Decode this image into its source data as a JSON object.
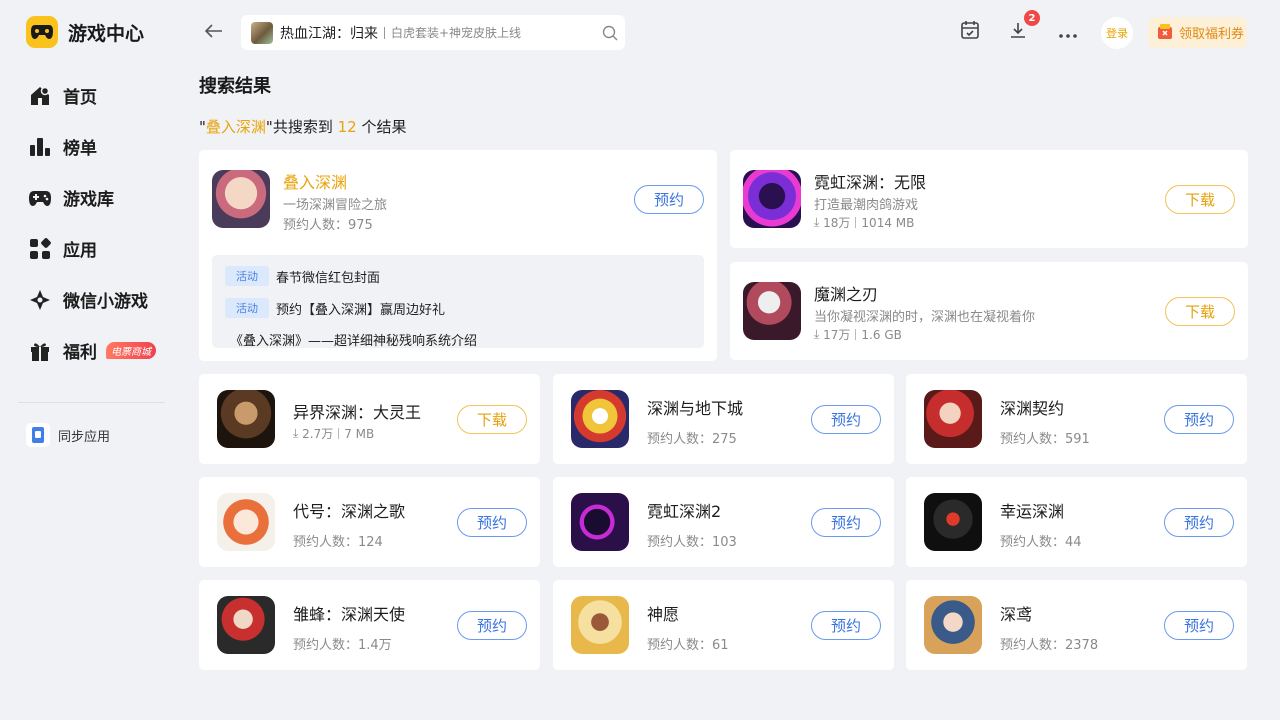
{
  "app": {
    "name": "游戏中心"
  },
  "nav": [
    {
      "id": "home",
      "label": "首页",
      "icon": "home-icon"
    },
    {
      "id": "ranking",
      "label": "榜单",
      "icon": "ranking-icon"
    },
    {
      "id": "library",
      "label": "游戏库",
      "icon": "gamepad-icon"
    },
    {
      "id": "apps",
      "label": "应用",
      "icon": "apps-icon"
    },
    {
      "id": "wechat",
      "label": "微信小游戏",
      "icon": "wechat-game-icon"
    },
    {
      "id": "welfare",
      "label": "福利",
      "icon": "gift-icon",
      "badge": "电票商城"
    }
  ],
  "sync": {
    "label": "同步应用"
  },
  "search": {
    "title": "热血江湖：归来",
    "subtitle": "白虎套装+神宠皮肤上线"
  },
  "topbar": {
    "download_count": "2",
    "login_label": "登录",
    "coupon_label": "领取福利券"
  },
  "page_title": "搜索结果",
  "summary": {
    "quote_open": "\"",
    "keyword": "叠入深渊",
    "middle": "\"共搜索到",
    "count": "12",
    "suffix": "个结果"
  },
  "featured": {
    "name": "叠入深渊",
    "desc": "一场深渊冒险之旅",
    "meta": "预约人数：975",
    "button": "预约",
    "activities": [
      {
        "tag": "活动",
        "text": "春节微信红包封面"
      },
      {
        "tag": "活动",
        "text": "预约【叠入深渊】赢周边好礼"
      },
      {
        "tag": "",
        "text": "《叠入深渊》——超详细神秘残响系统介绍"
      }
    ]
  },
  "side_cards": [
    {
      "name": "霓虹深渊：无限",
      "desc": "打造最潮肉鸽游戏",
      "downloads": "18万",
      "size": "1014 MB",
      "button": "下载"
    },
    {
      "name": "魔渊之刃",
      "desc": "当你凝视深渊的时，深渊也在凝视着你",
      "downloads": "17万",
      "size": "1.6 GB",
      "button": "下载"
    }
  ],
  "grid": [
    {
      "name": "异界深渊：大灵王",
      "downloads": "2.7万",
      "size": "7 MB",
      "meta": "",
      "button": "下载"
    },
    {
      "name": "深渊与地下城",
      "meta": "预约人数：275",
      "button": "预约"
    },
    {
      "name": "深渊契约",
      "meta": "预约人数：591",
      "button": "预约"
    },
    {
      "name": "代号：深渊之歌",
      "meta": "预约人数：124",
      "button": "预约"
    },
    {
      "name": "霓虹深渊2",
      "meta": "预约人数：103",
      "button": "预约"
    },
    {
      "name": "幸运深渊",
      "meta": "预约人数：44",
      "button": "预约"
    },
    {
      "name": "雏蜂：深渊天使",
      "meta": "预约人数：1.4万",
      "button": "预约"
    },
    {
      "name": "神愿",
      "meta": "预约人数：61",
      "button": "预约"
    },
    {
      "name": "深鸢",
      "meta": "预约人数：2378",
      "button": "预约"
    }
  ]
}
